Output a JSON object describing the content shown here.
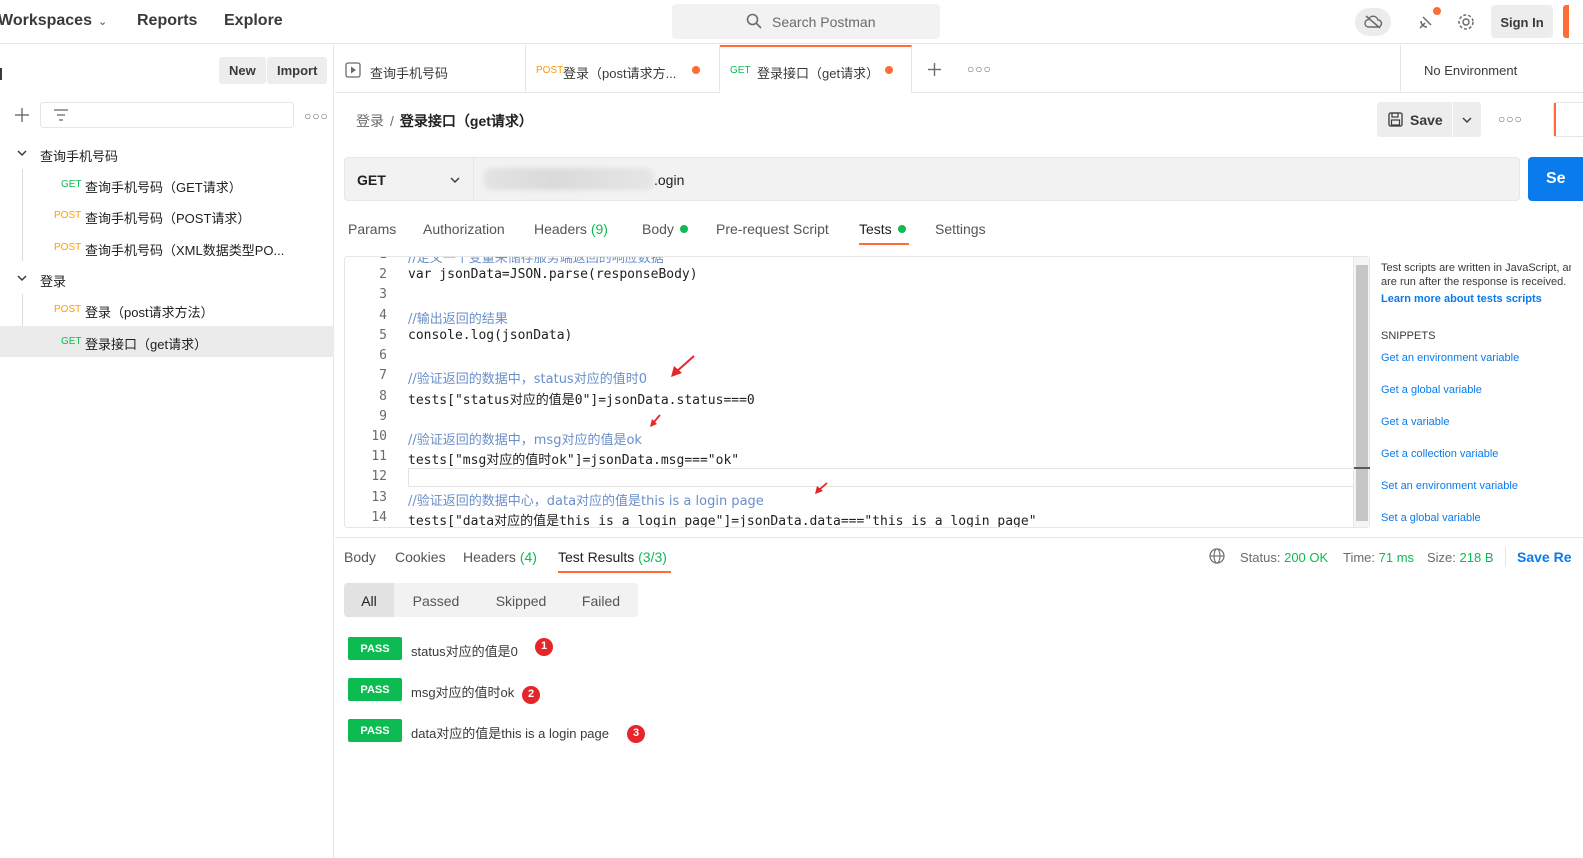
{
  "header": {
    "workspaces": "Workspaces",
    "reports": "Reports",
    "explore": "Explore",
    "search_placeholder": "Search Postman",
    "sign_in": "Sign In"
  },
  "sidebar": {
    "new_label": "New",
    "import_label": "Import",
    "tree": [
      {
        "type": "folder",
        "label": "查询手机号码"
      },
      {
        "type": "request",
        "method": "GET",
        "label": "查询手机号码（GET请求）"
      },
      {
        "type": "request",
        "method": "POST",
        "label": "查询手机号码（POST请求）"
      },
      {
        "type": "request",
        "method": "POST",
        "label": "查询手机号码（XML数据类型PO..."
      },
      {
        "type": "folder",
        "label": "登录"
      },
      {
        "type": "request",
        "method": "POST",
        "label": "登录（post请求方法）"
      },
      {
        "type": "request",
        "method": "GET",
        "label": "登录接口（get请求）",
        "selected": true
      }
    ]
  },
  "tabs": [
    {
      "method": "",
      "label": "查询手机号码",
      "active": false,
      "unsaved": false
    },
    {
      "method": "POST",
      "label": "登录（post请求方...",
      "active": false,
      "unsaved": true
    },
    {
      "method": "GET",
      "label": "登录接口（get请求）",
      "active": true,
      "unsaved": true
    }
  ],
  "environment": "No Environment",
  "breadcrumb": {
    "parent": "登录",
    "separator": "/",
    "current": "登录接口（get请求）"
  },
  "save_label": "Save",
  "request": {
    "method": "GET",
    "url_visible": ".ogin",
    "send_label": "Se"
  },
  "request_tabs": [
    {
      "label": "Params",
      "count": ""
    },
    {
      "label": "Authorization",
      "count": ""
    },
    {
      "label": "Headers",
      "count": "(9)"
    },
    {
      "label": "Body",
      "count": "",
      "dot": true
    },
    {
      "label": "Pre-request Script",
      "count": ""
    },
    {
      "label": "Tests",
      "count": "",
      "dot": true,
      "active": true
    },
    {
      "label": "Settings",
      "count": ""
    }
  ],
  "code_lines": [
    {
      "n": "1",
      "text": "//定义一个变量来储存服务端返回的响应数据"
    },
    {
      "n": "2",
      "text": "var jsonData=JSON.parse(responseBody)"
    },
    {
      "n": "3",
      "text": ""
    },
    {
      "n": "4",
      "text": "//输出返回的结果"
    },
    {
      "n": "5",
      "text": "console.log(jsonData)"
    },
    {
      "n": "6",
      "text": ""
    },
    {
      "n": "7",
      "text": "//验证返回的数据中，status对应的值时0"
    },
    {
      "n": "8",
      "text": "tests[\"status对应的值是0\"]=jsonData.status===0"
    },
    {
      "n": "9",
      "text": ""
    },
    {
      "n": "10",
      "text": "//验证返回的数据中，msg对应的值是ok"
    },
    {
      "n": "11",
      "text": "tests[\"msg对应的值时ok\"]=jsonData.msg===\"ok\""
    },
    {
      "n": "12",
      "text": ""
    },
    {
      "n": "13",
      "text": "//验证返回的数据中心，data对应的值是this is a login page"
    },
    {
      "n": "14",
      "text": "tests[\"data对应的值是this is a login page\"]=jsonData.data===\"this is a login page\""
    }
  ],
  "snippets": {
    "help_line1": "Test scripts are written in JavaScript, and",
    "help_line2": "are run after the response is received.",
    "learn_more": "Learn more about tests scripts",
    "heading": "SNIPPETS",
    "items": [
      "Get an environment variable",
      "Get a global variable",
      "Get a variable",
      "Get a collection variable",
      "Set an environment variable",
      "Set a global variable"
    ]
  },
  "response_tabs": [
    {
      "label": "Body",
      "count": ""
    },
    {
      "label": "Cookies",
      "count": ""
    },
    {
      "label": "Headers",
      "count": "(4)"
    },
    {
      "label": "Test Results",
      "count": "(3/3)",
      "active": true
    }
  ],
  "response_status": {
    "status_label": "Status:",
    "status_value": "200 OK",
    "time_label": "Time:",
    "time_value": "71 ms",
    "size_label": "Size:",
    "size_value": "218 B",
    "save_response": "Save Re"
  },
  "result_filters": [
    "All",
    "Passed",
    "Skipped",
    "Failed"
  ],
  "results": [
    {
      "status": "PASS",
      "name": "status对应的值是0",
      "marker": "1"
    },
    {
      "status": "PASS",
      "name": "msg对应的值时ok",
      "marker": "2"
    },
    {
      "status": "PASS",
      "name": "data对应的值是this is a login page",
      "marker": "3"
    }
  ],
  "colors": {
    "accent": "#ff6c37",
    "get": "#0cbb52",
    "post": "#ff9b00",
    "pass": "#0cbb52",
    "link": "#097bed",
    "marker": "#e5252a"
  }
}
